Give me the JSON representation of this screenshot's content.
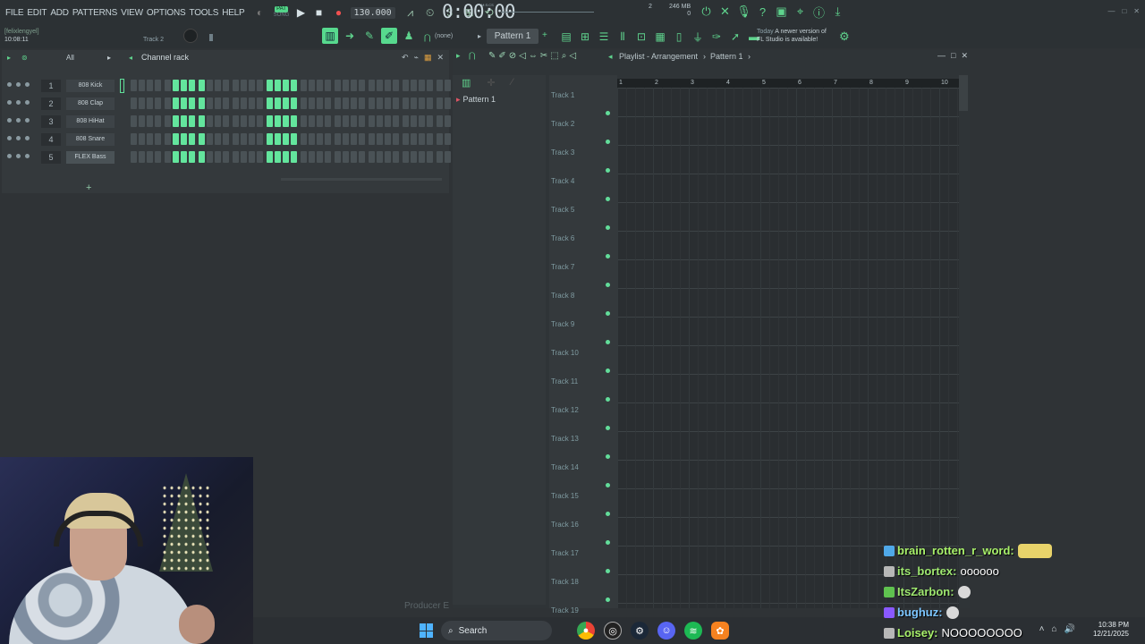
{
  "menu": [
    "FILE",
    "EDIT",
    "ADD",
    "PATTERNS",
    "VIEW",
    "OPTIONS",
    "TOOLS",
    "HELP"
  ],
  "transport": {
    "pat": "PAT",
    "song": "SONG",
    "tempo": "130.000",
    "time": "0:00:00",
    "time_unit": "M:S:CS"
  },
  "perf": {
    "cpu_number": "2",
    "memory": "246 MB",
    "poly": "0"
  },
  "user": {
    "name": "[felixlengyel]",
    "clock": "10:08:11",
    "track": "Track 2"
  },
  "toolbar": {
    "pattern_none": "(none)",
    "pattern_selected": "Pattern 1",
    "news_today": "Today",
    "news_line1": "A newer version of",
    "news_line2": "FL Studio is available!"
  },
  "channel_rack": {
    "filter": "All",
    "title": "Channel rack",
    "channels": [
      {
        "num": "1",
        "name": "808 Kick"
      },
      {
        "num": "2",
        "name": "808 Clap"
      },
      {
        "num": "3",
        "name": "808 HiHat"
      },
      {
        "num": "4",
        "name": "808 Snare"
      },
      {
        "num": "5",
        "name": "FLEX Bass"
      }
    ],
    "add": "+"
  },
  "playlist": {
    "title": "Playlist - Arrangement",
    "pattern": "Pattern 1",
    "pattern_item": "Pattern 1",
    "ruler": [
      "1",
      "2",
      "3",
      "4",
      "5",
      "6",
      "7",
      "8",
      "9",
      "10"
    ],
    "tracks": [
      "Track 1",
      "Track 2",
      "Track 3",
      "Track 4",
      "Track 5",
      "Track 6",
      "Track 7",
      "Track 8",
      "Track 9",
      "Track 10",
      "Track 11",
      "Track 12",
      "Track 13",
      "Track 14",
      "Track 15",
      "Track 16",
      "Track 17",
      "Track 18",
      "Track 19"
    ]
  },
  "producer_label": "Producer E",
  "taskbar": {
    "search": "Search",
    "time": "10:38 PM",
    "date": "12/21/2025"
  },
  "chat": [
    {
      "user": "brain_rotten_r_word:",
      "color": "#a8f06a",
      "badge": "#4fa8e8",
      "message": "",
      "emote": "large"
    },
    {
      "user": "its_bortex:",
      "color": "#9fe870",
      "badge": "#b7b7b7",
      "message": "oooooo",
      "emote": ""
    },
    {
      "user": "ItsZarbon:",
      "color": "#9fe870",
      "badge": "#5fc24f",
      "message": "",
      "emote": "small"
    },
    {
      "user": "bughuz:",
      "color": "#7cc6ff",
      "badge": "#8a59ff",
      "message": "",
      "emote": "small"
    },
    {
      "user": "Loisey:",
      "color": "#a8f06a",
      "badge": "#b7b7b7",
      "message": "NOOOOOOOO",
      "emote": ""
    }
  ],
  "colors": {
    "accent": "#5fd38d",
    "step_on": "#63e59d",
    "panel": "#34393c"
  },
  "icons": [
    "play-icon",
    "stop-icon",
    "record-icon",
    "metronome-icon",
    "mixer-icon",
    "piano-roll-icon",
    "browser-icon",
    "plugin-icon",
    "pencil-icon",
    "paint-icon",
    "delete-icon",
    "mute-icon",
    "slice-icon",
    "select-icon",
    "zoom-icon",
    "playback-icon",
    "windows-icon",
    "search-icon",
    "chrome-icon",
    "steam-icon",
    "discord-icon",
    "spotify-icon",
    "fl-studio-icon"
  ]
}
